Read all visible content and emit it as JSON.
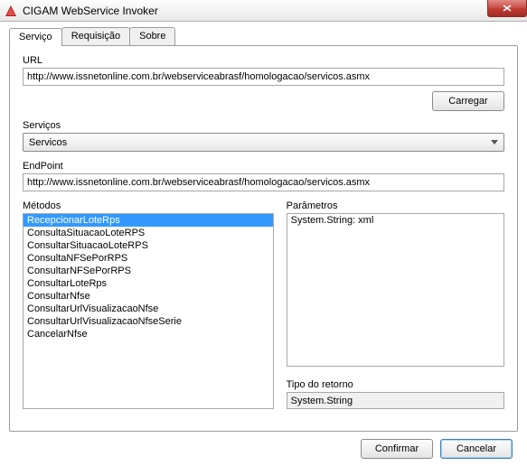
{
  "window": {
    "title": "CIGAM WebService Invoker"
  },
  "tabs": {
    "servico": "Serviço",
    "requisicao": "Requisição",
    "sobre": "Sobre"
  },
  "url": {
    "label": "URL",
    "value": "http://www.issnetonline.com.br/webserviceabrasf/homologacao/servicos.asmx"
  },
  "buttons": {
    "carregar": "Carregar",
    "confirmar": "Confirmar",
    "cancelar": "Cancelar"
  },
  "servicos": {
    "label": "Serviços",
    "selected": "Servicos"
  },
  "endpoint": {
    "label": "EndPoint",
    "value": "http://www.issnetonline.com.br/webserviceabrasf/homologacao/servicos.asmx"
  },
  "metodos": {
    "label": "Métodos",
    "items": [
      "RecepcionarLoteRps",
      "ConsultaSituacaoLoteRPS",
      "ConsultarSituacaoLoteRPS",
      "ConsultaNFSePorRPS",
      "ConsultarNFSePorRPS",
      "ConsultarLoteRps",
      "ConsultarNfse",
      "ConsultarUrlVisualizacaoNfse",
      "ConsultarUrlVisualizacaoNfseSerie",
      "CancelarNfse"
    ],
    "selectedIndex": 0
  },
  "parametros": {
    "label": "Parâmetros",
    "value": "System.String: xml"
  },
  "retorno": {
    "label": "Tipo do retorno",
    "value": "System.String"
  }
}
